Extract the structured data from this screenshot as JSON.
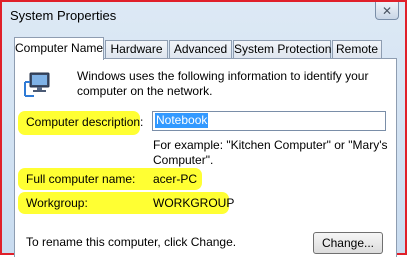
{
  "window": {
    "title": "System Properties",
    "close_glyph": "✕"
  },
  "tabs": [
    {
      "label": "Computer Name",
      "active": true
    },
    {
      "label": "Hardware",
      "active": false
    },
    {
      "label": "Advanced",
      "active": false
    },
    {
      "label": "System Protection",
      "active": false
    },
    {
      "label": "Remote",
      "active": false
    }
  ],
  "content": {
    "intro": "Windows uses the following information to identify your computer on the network.",
    "description_label": "Computer description:",
    "description_value": "Notebook",
    "example": "For example: \"Kitchen Computer\" or \"Mary's Computer\".",
    "full_name_label": "Full computer name:",
    "full_name_value": "acer-PC",
    "workgroup_label": "Workgroup:",
    "workgroup_value": "WORKGROUP",
    "rename_text": "To rename this computer, click Change.",
    "change_button": "Change..."
  },
  "colors": {
    "highlight": "#ffff33",
    "selection": "#3399ff",
    "frame": "#e0202a"
  },
  "icons": {
    "computer": "computer-network-icon",
    "close": "close-icon"
  }
}
